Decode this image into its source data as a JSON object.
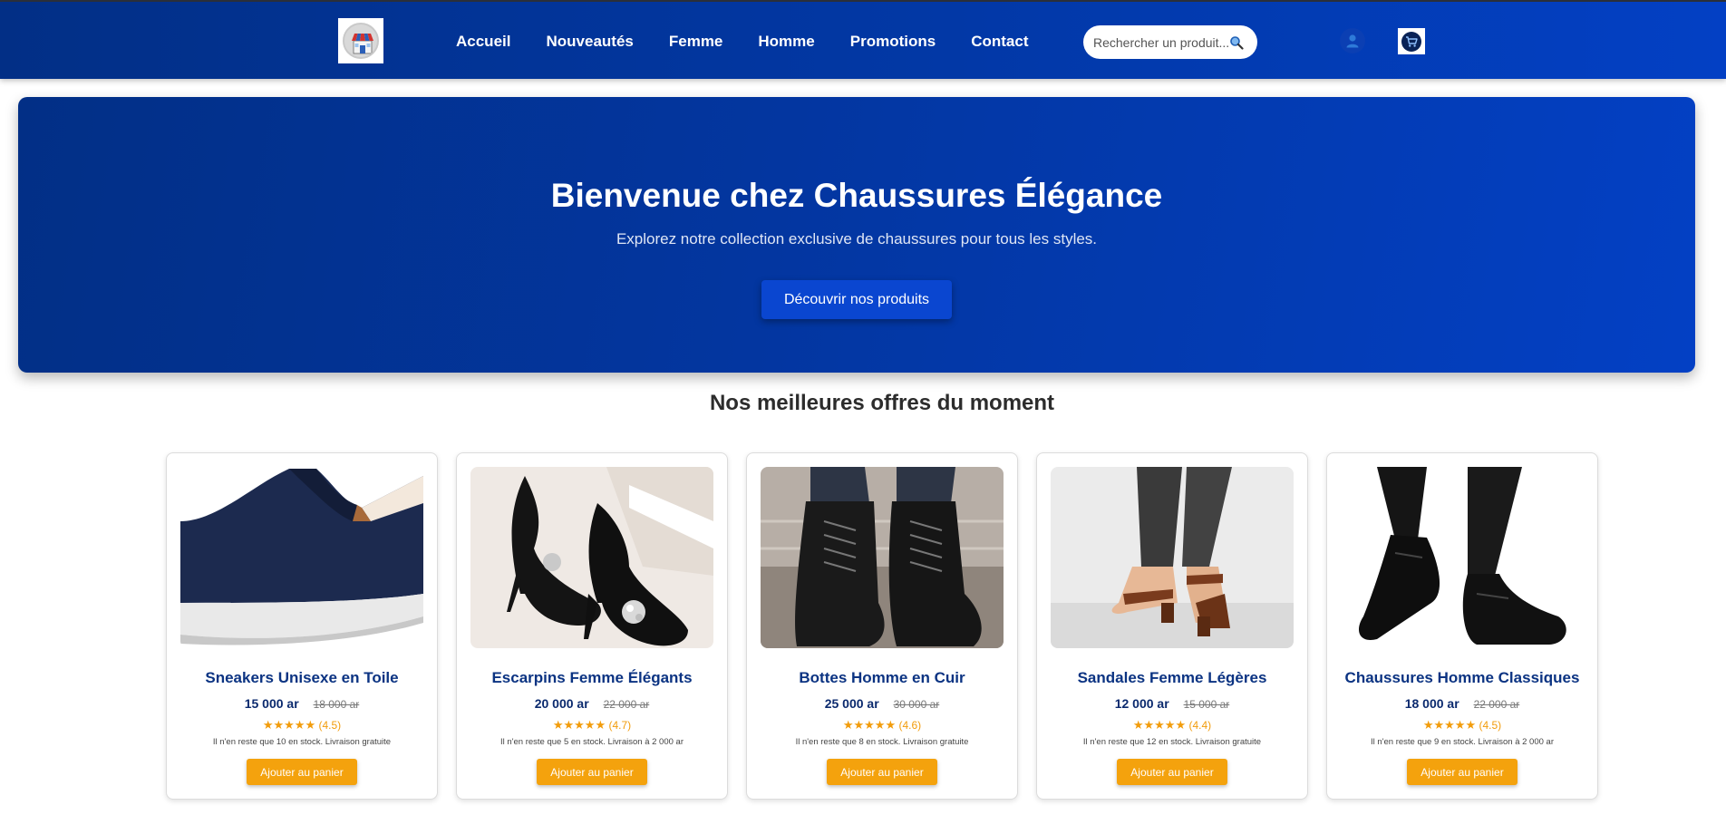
{
  "colors": {
    "nav_bg": "#0238a6",
    "hero_bg": "#0336a0",
    "hero_button": "#0a46d0",
    "product_name": "#0b3382",
    "add_button": "#f4a20d",
    "rating": "#f29c0b"
  },
  "nav": {
    "logo_icon": "store-icon",
    "links": [
      "Accueil",
      "Nouveautés",
      "Femme",
      "Homme",
      "Promotions",
      "Contact"
    ],
    "search_placeholder": "Rechercher un produit...",
    "search_icon": "search-icon",
    "user_icon": "user-icon",
    "cart_icon": "cart-icon"
  },
  "hero": {
    "title": "Bienvenue chez Chaussures Élégance",
    "subtitle": "Explorez notre collection exclusive de chaussures pour tous les styles.",
    "cta": "Découvrir nos produits"
  },
  "offers": {
    "title": "Nos meilleures offres du moment",
    "products": [
      {
        "name": "Sneakers Unisexe en Toile",
        "price": "15 000 ar",
        "old_price": "18 000 ar",
        "stars": "★★★★★",
        "rating": "(4.5)",
        "stock": "Il n'en reste que 10 en stock. Livraison gratuite",
        "button": "Ajouter au panier"
      },
      {
        "name": "Escarpins Femme Élégants",
        "price": "20 000 ar",
        "old_price": "22 000 ar",
        "stars": "★★★★★",
        "rating": "(4.7)",
        "stock": "Il n'en reste que 5 en stock. Livraison à 2 000 ar",
        "button": "Ajouter au panier"
      },
      {
        "name": "Bottes Homme en Cuir",
        "price": "25 000 ar",
        "old_price": "30 000 ar",
        "stars": "★★★★★",
        "rating": "(4.6)",
        "stock": "Il n'en reste que 8 en stock. Livraison gratuite",
        "button": "Ajouter au panier"
      },
      {
        "name": "Sandales Femme Légères",
        "price": "12 000 ar",
        "old_price": "15 000 ar",
        "stars": "★★★★★",
        "rating": "(4.4)",
        "stock": "Il n'en reste que 12 en stock. Livraison gratuite",
        "button": "Ajouter au panier"
      },
      {
        "name": "Chaussures Homme Classiques",
        "price": "18 000 ar",
        "old_price": "22 000 ar",
        "stars": "★★★★★",
        "rating": "(4.5)",
        "stock": "Il n'en reste que 9 en stock. Livraison à 2 000 ar",
        "button": "Ajouter au panier"
      }
    ]
  }
}
